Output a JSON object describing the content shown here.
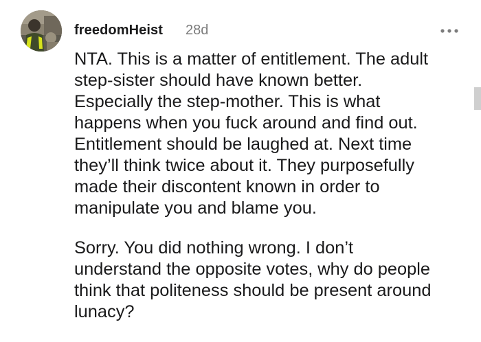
{
  "comment": {
    "author": "freedomHeist",
    "age": "28d",
    "more_icon": "more-horizontal-icon",
    "paragraphs": [
      "NTA. This is a matter of entitlement. The adult\nstep-sister should have known better.\nEspecially the step-mother. This is what\nhappens when you fuck around and find out.\nEntitlement should be laughed at. Next time\nthey’ll think twice about it. They purposefully\nmade their discontent known in order to\nmanipulate you and blame you.",
      "Sorry. You did nothing wrong. I don’t\nunderstand the opposite votes, why do people\nthink that politeness should be present around\nlunacy?"
    ]
  },
  "colors": {
    "text": "#1a1a1b",
    "meta": "#7c7c7c",
    "scrollbar": "#cfcfcf"
  }
}
